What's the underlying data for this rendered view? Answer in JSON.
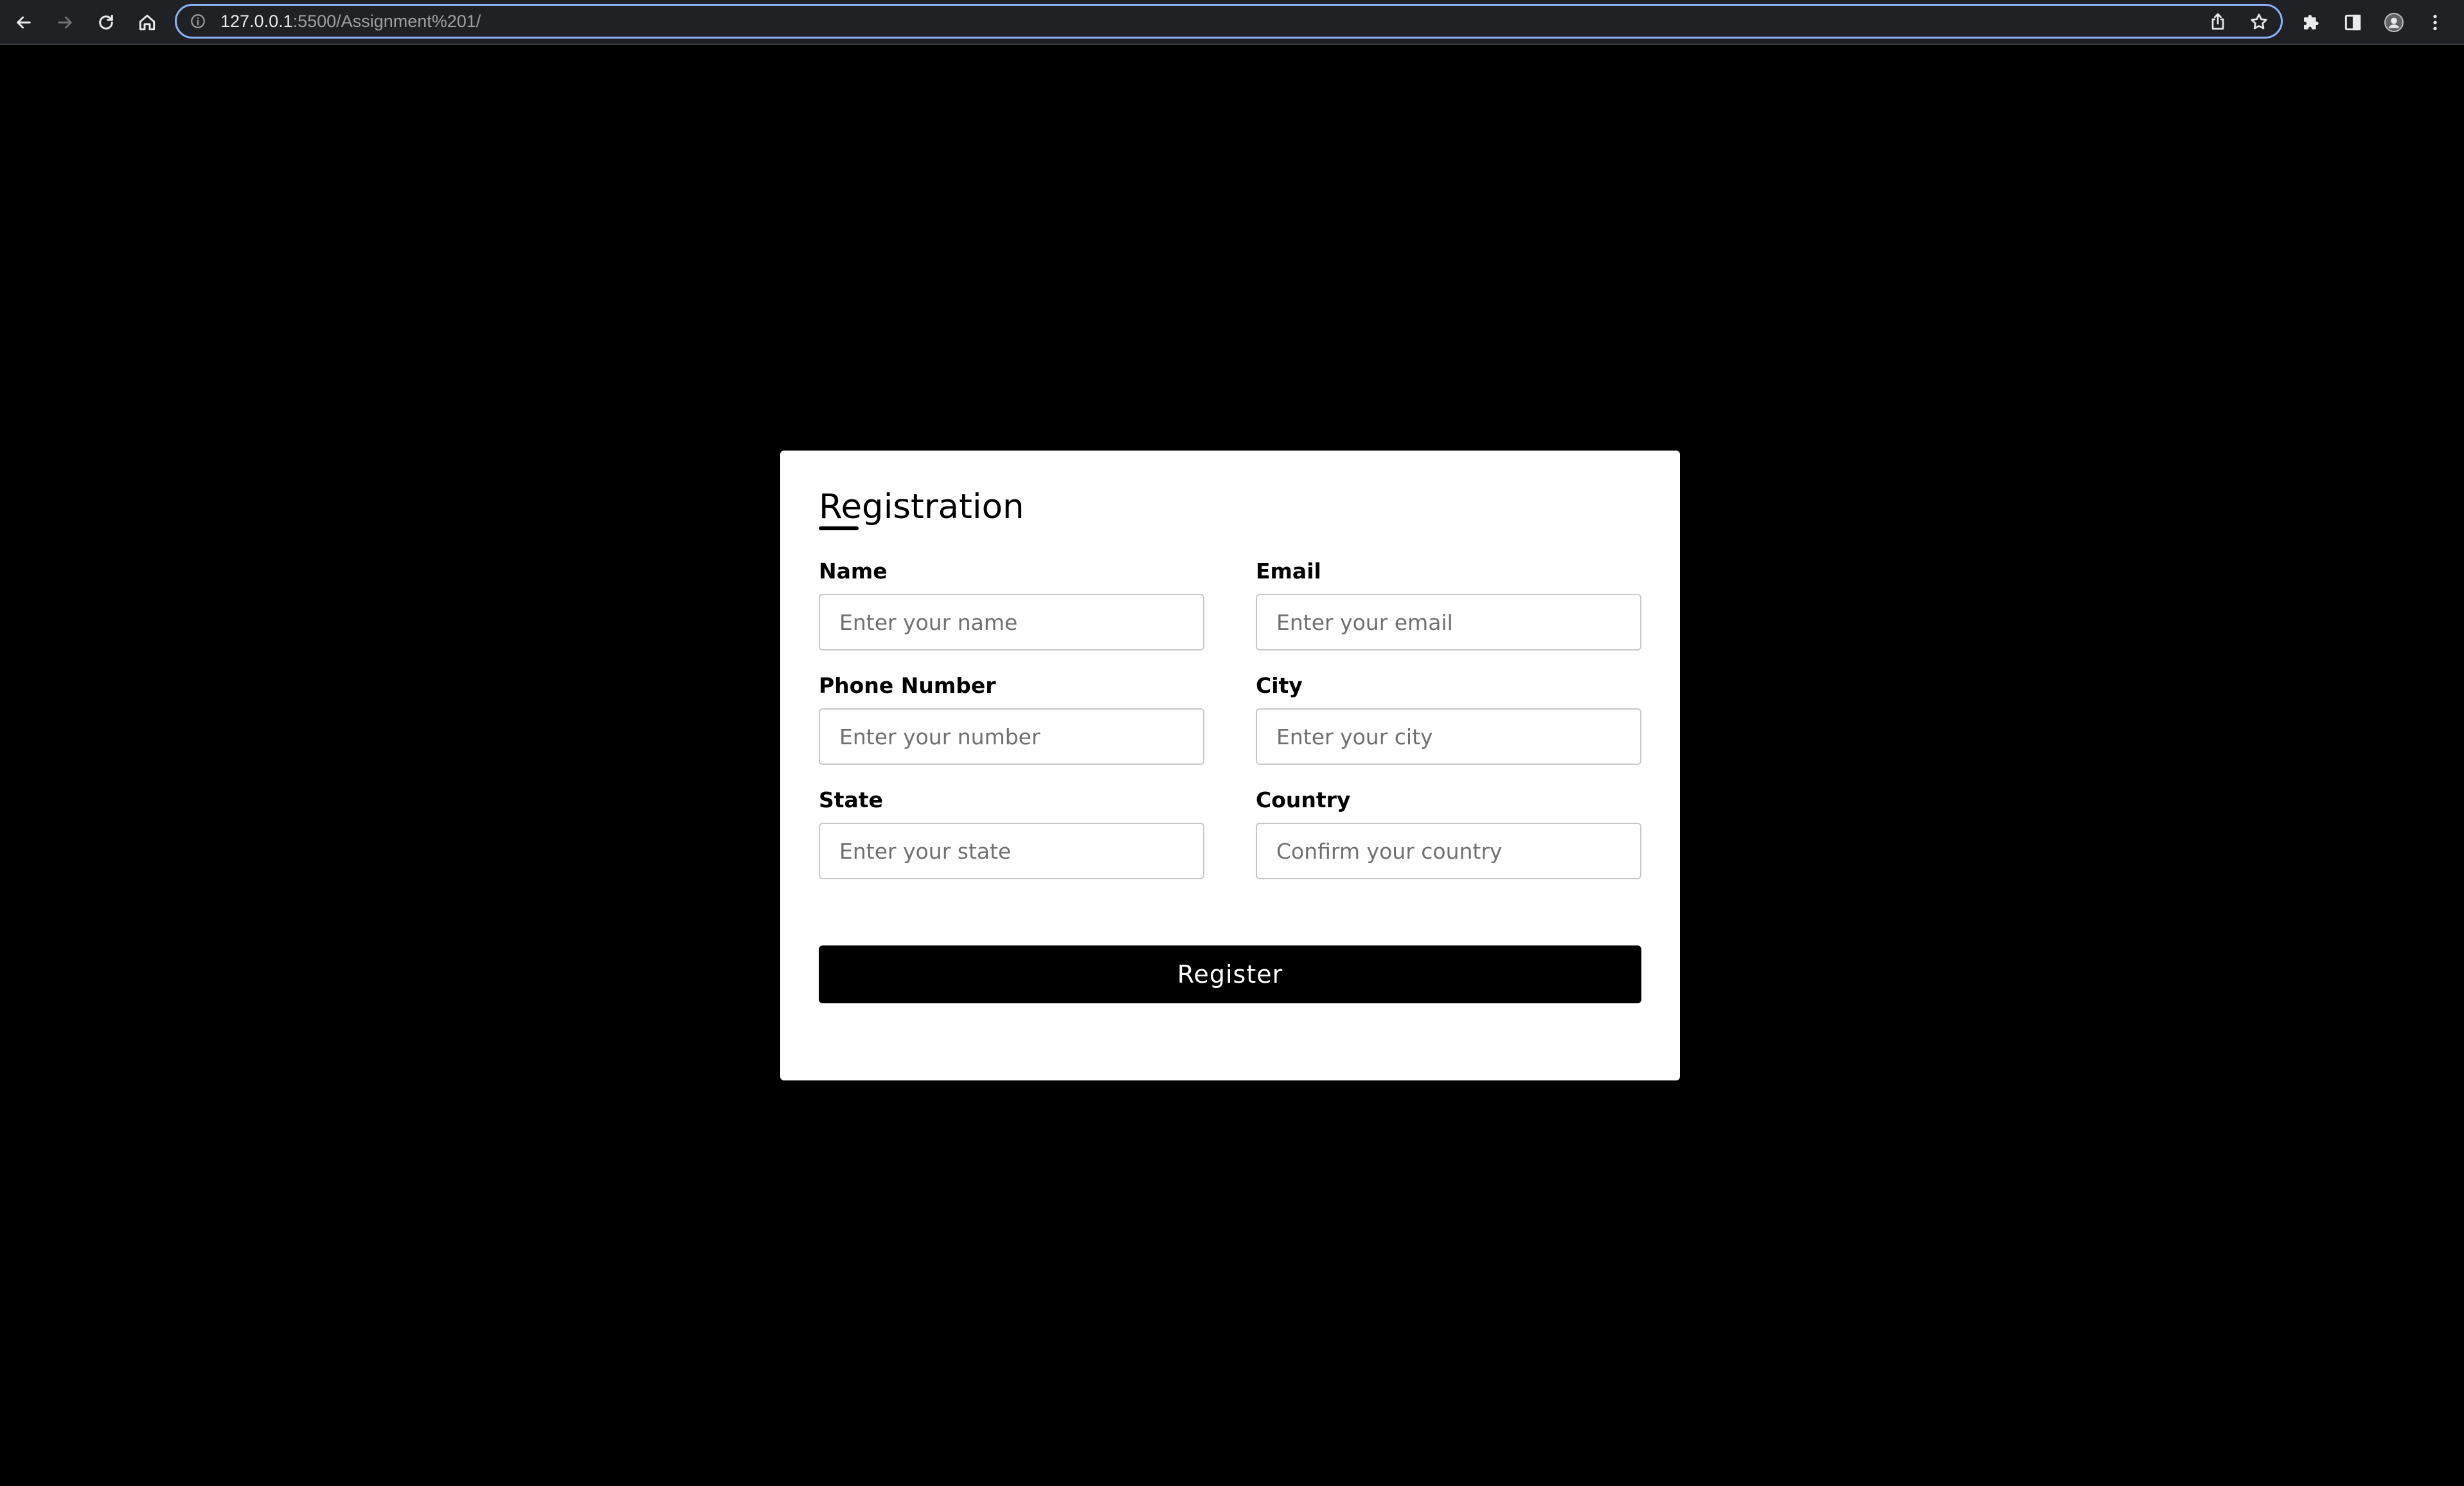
{
  "browser": {
    "url_host": "127.0.0.1",
    "url_rest": ":5500/Assignment%201/",
    "icons": {
      "back": "back-arrow-icon",
      "forward": "forward-arrow-icon",
      "reload": "reload-icon",
      "home": "home-icon",
      "info": "info-icon",
      "share": "share-icon",
      "bookmark": "star-icon",
      "extensions": "puzzle-icon",
      "side_panel": "side-panel-icon",
      "profile": "avatar-icon",
      "menu": "kebab-menu-icon"
    }
  },
  "form": {
    "title": "Registration",
    "fields": [
      {
        "label": "Name",
        "placeholder": "Enter your name",
        "value": ""
      },
      {
        "label": "Email",
        "placeholder": "Enter your email",
        "value": ""
      },
      {
        "label": "Phone Number",
        "placeholder": "Enter your number",
        "value": ""
      },
      {
        "label": "City",
        "placeholder": "Enter your city",
        "value": ""
      },
      {
        "label": "State",
        "placeholder": "Enter your state",
        "value": ""
      },
      {
        "label": "Country",
        "placeholder": "Confirm your country",
        "value": ""
      }
    ],
    "submit_label": "Register"
  },
  "colors": {
    "page_background": "#000000",
    "card_background": "#ffffff",
    "button_background": "#000000",
    "button_text": "#ffffff",
    "omnibox_focus": "#8ab4f8"
  }
}
